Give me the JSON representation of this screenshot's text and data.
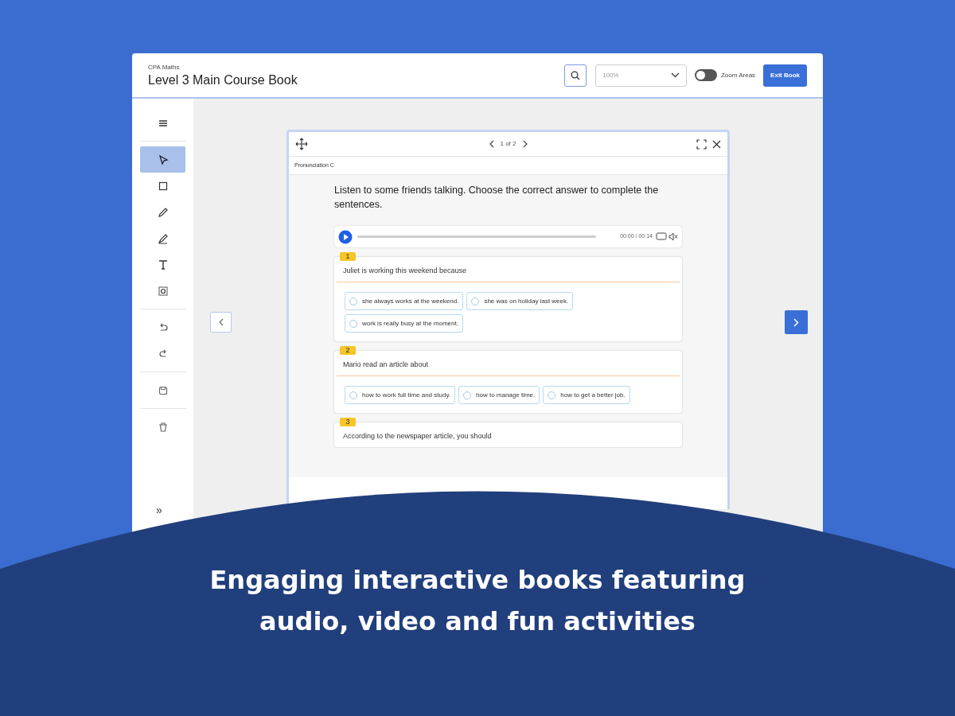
{
  "header": {
    "subtitle": "CPA Maths",
    "title": "Level 3 Main Course Book",
    "zoom": {
      "value": "100%"
    },
    "zoom_areas": {
      "label": "Zoom Areas",
      "on": false
    },
    "exit_button": "Exit Book"
  },
  "sidebar": {
    "tool_groups": [
      {
        "tools": [
          {
            "kind": "menu",
            "selected": false
          }
        ]
      },
      {
        "tools": [
          {
            "kind": "pointer",
            "selected": true
          },
          {
            "kind": "square",
            "selected": false
          },
          {
            "kind": "pencil",
            "selected": false
          },
          {
            "kind": "highlighter",
            "selected": false
          },
          {
            "kind": "text",
            "selected": false
          },
          {
            "kind": "focus",
            "selected": false
          }
        ]
      },
      {
        "tools": [
          {
            "kind": "undo",
            "selected": false
          },
          {
            "kind": "redo",
            "selected": false
          }
        ]
      },
      {
        "tools": [
          {
            "kind": "save",
            "selected": false
          }
        ]
      },
      {
        "tools": [
          {
            "kind": "trash",
            "selected": false
          }
        ]
      }
    ],
    "expand": "»"
  },
  "activity": {
    "pager": "1 of 2",
    "section": "Pronunciation C",
    "instruction": "Listen to some friends talking. Choose the correct answer to complete the sentences.",
    "audio": {
      "time": "00:00 / 00:14"
    },
    "questions": [
      {
        "number": "1",
        "text": "Juliet is working this weekend because",
        "options": [
          {
            "label": "she always works at the weekend.",
            "selected": false
          },
          {
            "label": "she was on holiday last week.",
            "selected": false
          },
          {
            "label": "work is really busy at the moment.",
            "selected": false
          }
        ]
      },
      {
        "number": "2",
        "text": "Mario read an article about",
        "options": [
          {
            "label": "how to work full time and study.",
            "selected": false
          },
          {
            "label": "how to manage time.",
            "selected": false
          },
          {
            "label": "how to get a better job.",
            "selected": false
          }
        ]
      },
      {
        "number": "3",
        "text": "According to the newspaper article, you should"
      }
    ]
  },
  "caption": [
    "Engaging interactive books featuring",
    "audio, video and fun activities"
  ]
}
